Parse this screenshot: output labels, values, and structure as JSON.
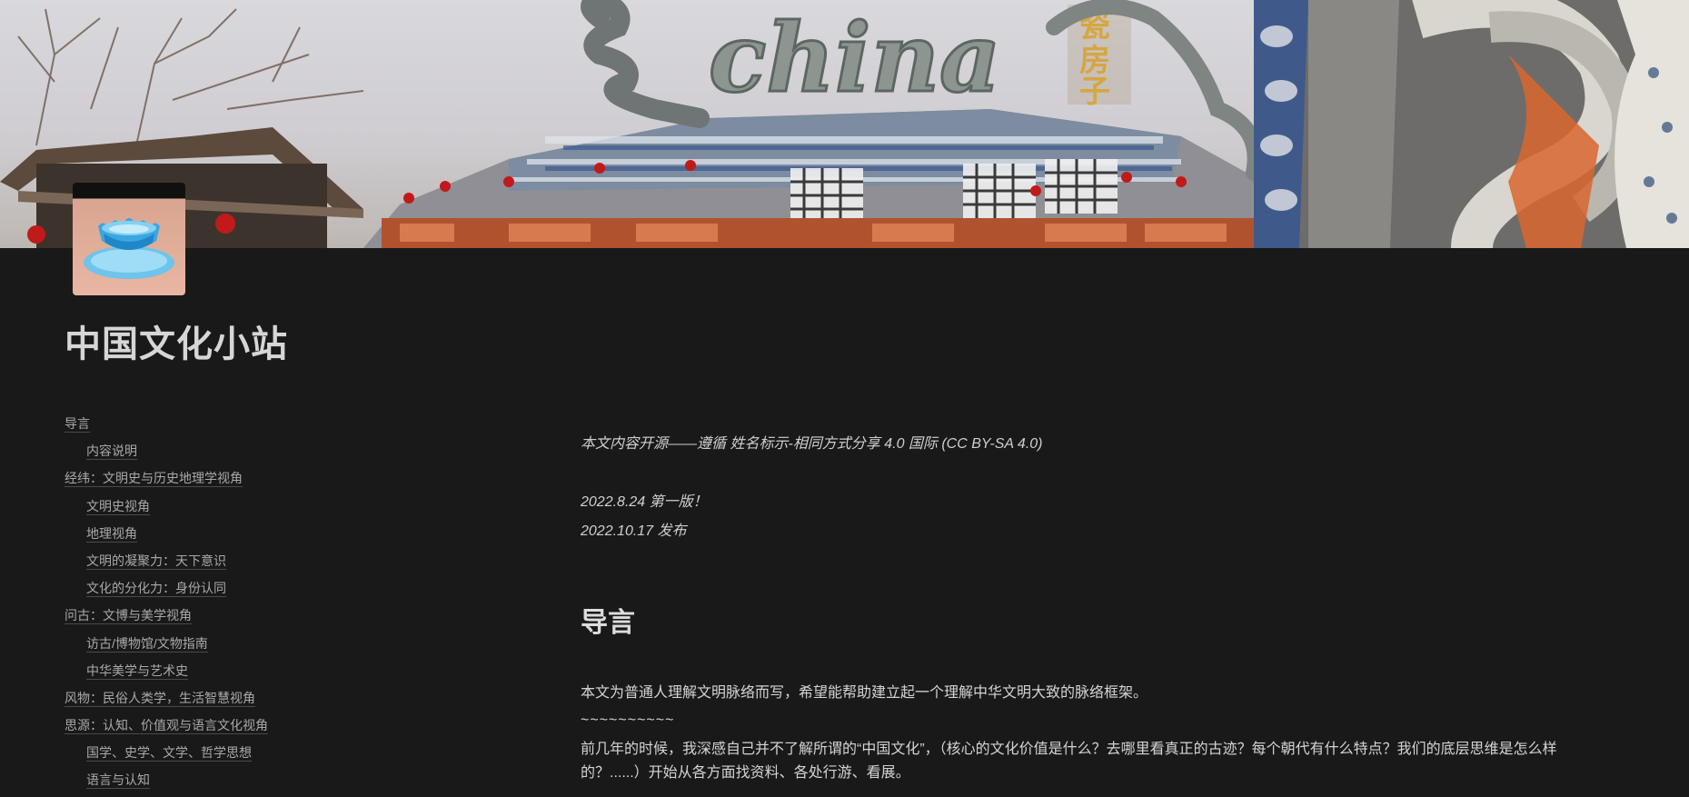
{
  "page": {
    "title": "中国文化小站"
  },
  "cover": {
    "sign_text": "china",
    "vertical_sign": "瓷房子"
  },
  "toc": [
    {
      "label": "导言",
      "level": 1
    },
    {
      "label": "内容说明",
      "level": 2
    },
    {
      "label": "经纬：文明史与历史地理学视角",
      "level": 1
    },
    {
      "label": "文明史视角",
      "level": 2
    },
    {
      "label": "地理视角",
      "level": 2
    },
    {
      "label": "文明的凝聚力：天下意识",
      "level": 2
    },
    {
      "label": "文化的分化力：身份认同",
      "level": 2
    },
    {
      "label": "问古：文博与美学视角",
      "level": 1
    },
    {
      "label": "访古/博物馆/文物指南",
      "level": 2
    },
    {
      "label": "中华美学与艺术史",
      "level": 2
    },
    {
      "label": "风物：民俗人类学，生活智慧视角",
      "level": 1
    },
    {
      "label": "思源：认知、价值观与语言文化视角",
      "level": 1
    },
    {
      "label": "国学、史学、文学、哲学思想",
      "level": 2
    },
    {
      "label": "语言与认知",
      "level": 2
    }
  ],
  "content": {
    "license": "本文内容开源——遵循 姓名标示-相同方式分享 4.0 国际 (CC BY-SA 4.0)",
    "version_1": "2022.8.24 第一版！",
    "version_2": "2022.10.17 发布",
    "heading_intro": "导言",
    "para_1": "本文为普通人理解文明脉络而写，希望能帮助建立起一个理解中华文明大致的脉络框架。",
    "tilde_line": "~~~~~~~~~~",
    "para_2": "前几年的时候，我深感自己并不了解所谓的“中国文化”，（核心的文化价值是什么？去哪里看真正的古迹？每个朝代有什么特点？我们的底层思维是怎么样的？......）开始从各方面找资料、各处行游、看展。"
  },
  "colors": {
    "background": "#191919",
    "text": "#d4d4d4",
    "toc_text": "#a9a9a9"
  }
}
